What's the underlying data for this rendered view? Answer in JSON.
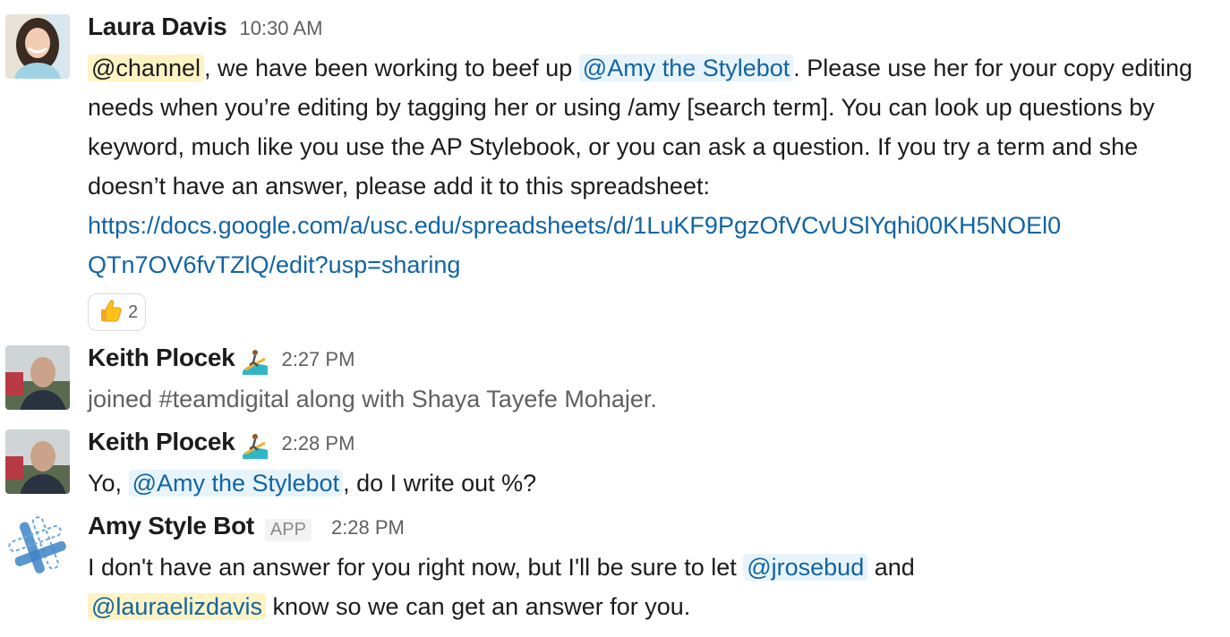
{
  "messages": [
    {
      "author": "Laura Davis",
      "time": "10:30 AM",
      "mention_channel": "@channel",
      "text_1": ", we have been working to beef up ",
      "mention_bot": "@Amy the Stylebot",
      "text_2": ". Please use her for your copy editing needs when you’re editing by tagging her or using /amy [search term]. You can look up questions by keyword, much like you use the AP Stylebook, or you can ask a question. If you try a term and she doesn’t have an answer, please add it to this spreadsheet: ",
      "link_line_1": "https://docs.google.com/a/usc.edu/spreadsheets/d/1LuKF9PgzOfVCvUSlYqhi00KH5NOEl0",
      "link_line_2": "QTn7OV6fvTZlQ/edit?usp=sharing",
      "reaction": {
        "icon": "thumbs-up-icon",
        "count": "2"
      }
    },
    {
      "author": "Keith Plocek",
      "status_emoji": "surfer-emoji",
      "time": "2:27 PM",
      "text": "joined #teamdigital along with Shaya Tayefe Mohajer."
    },
    {
      "author": "Keith Plocek",
      "status_emoji": "surfer-emoji",
      "time": "2:28 PM",
      "text_1": "Yo, ",
      "mention_bot": "@Amy the Stylebot",
      "text_2": ", do I write out %?"
    },
    {
      "author": "Amy Style Bot",
      "badge": "APP",
      "time": "2:28 PM",
      "text_1": "I don't have an answer for you right now, but I'll be sure to let ",
      "mention_1": "@jrosebud",
      "text_2": " and ",
      "mention_2": "@lauraelizdavis",
      "text_3": " know so we can get an answer for you."
    }
  ],
  "colors": {
    "link": "#1264a3",
    "mention_bg": "#e8f4fb",
    "channel_mention_bg": "#fdf3c4"
  }
}
